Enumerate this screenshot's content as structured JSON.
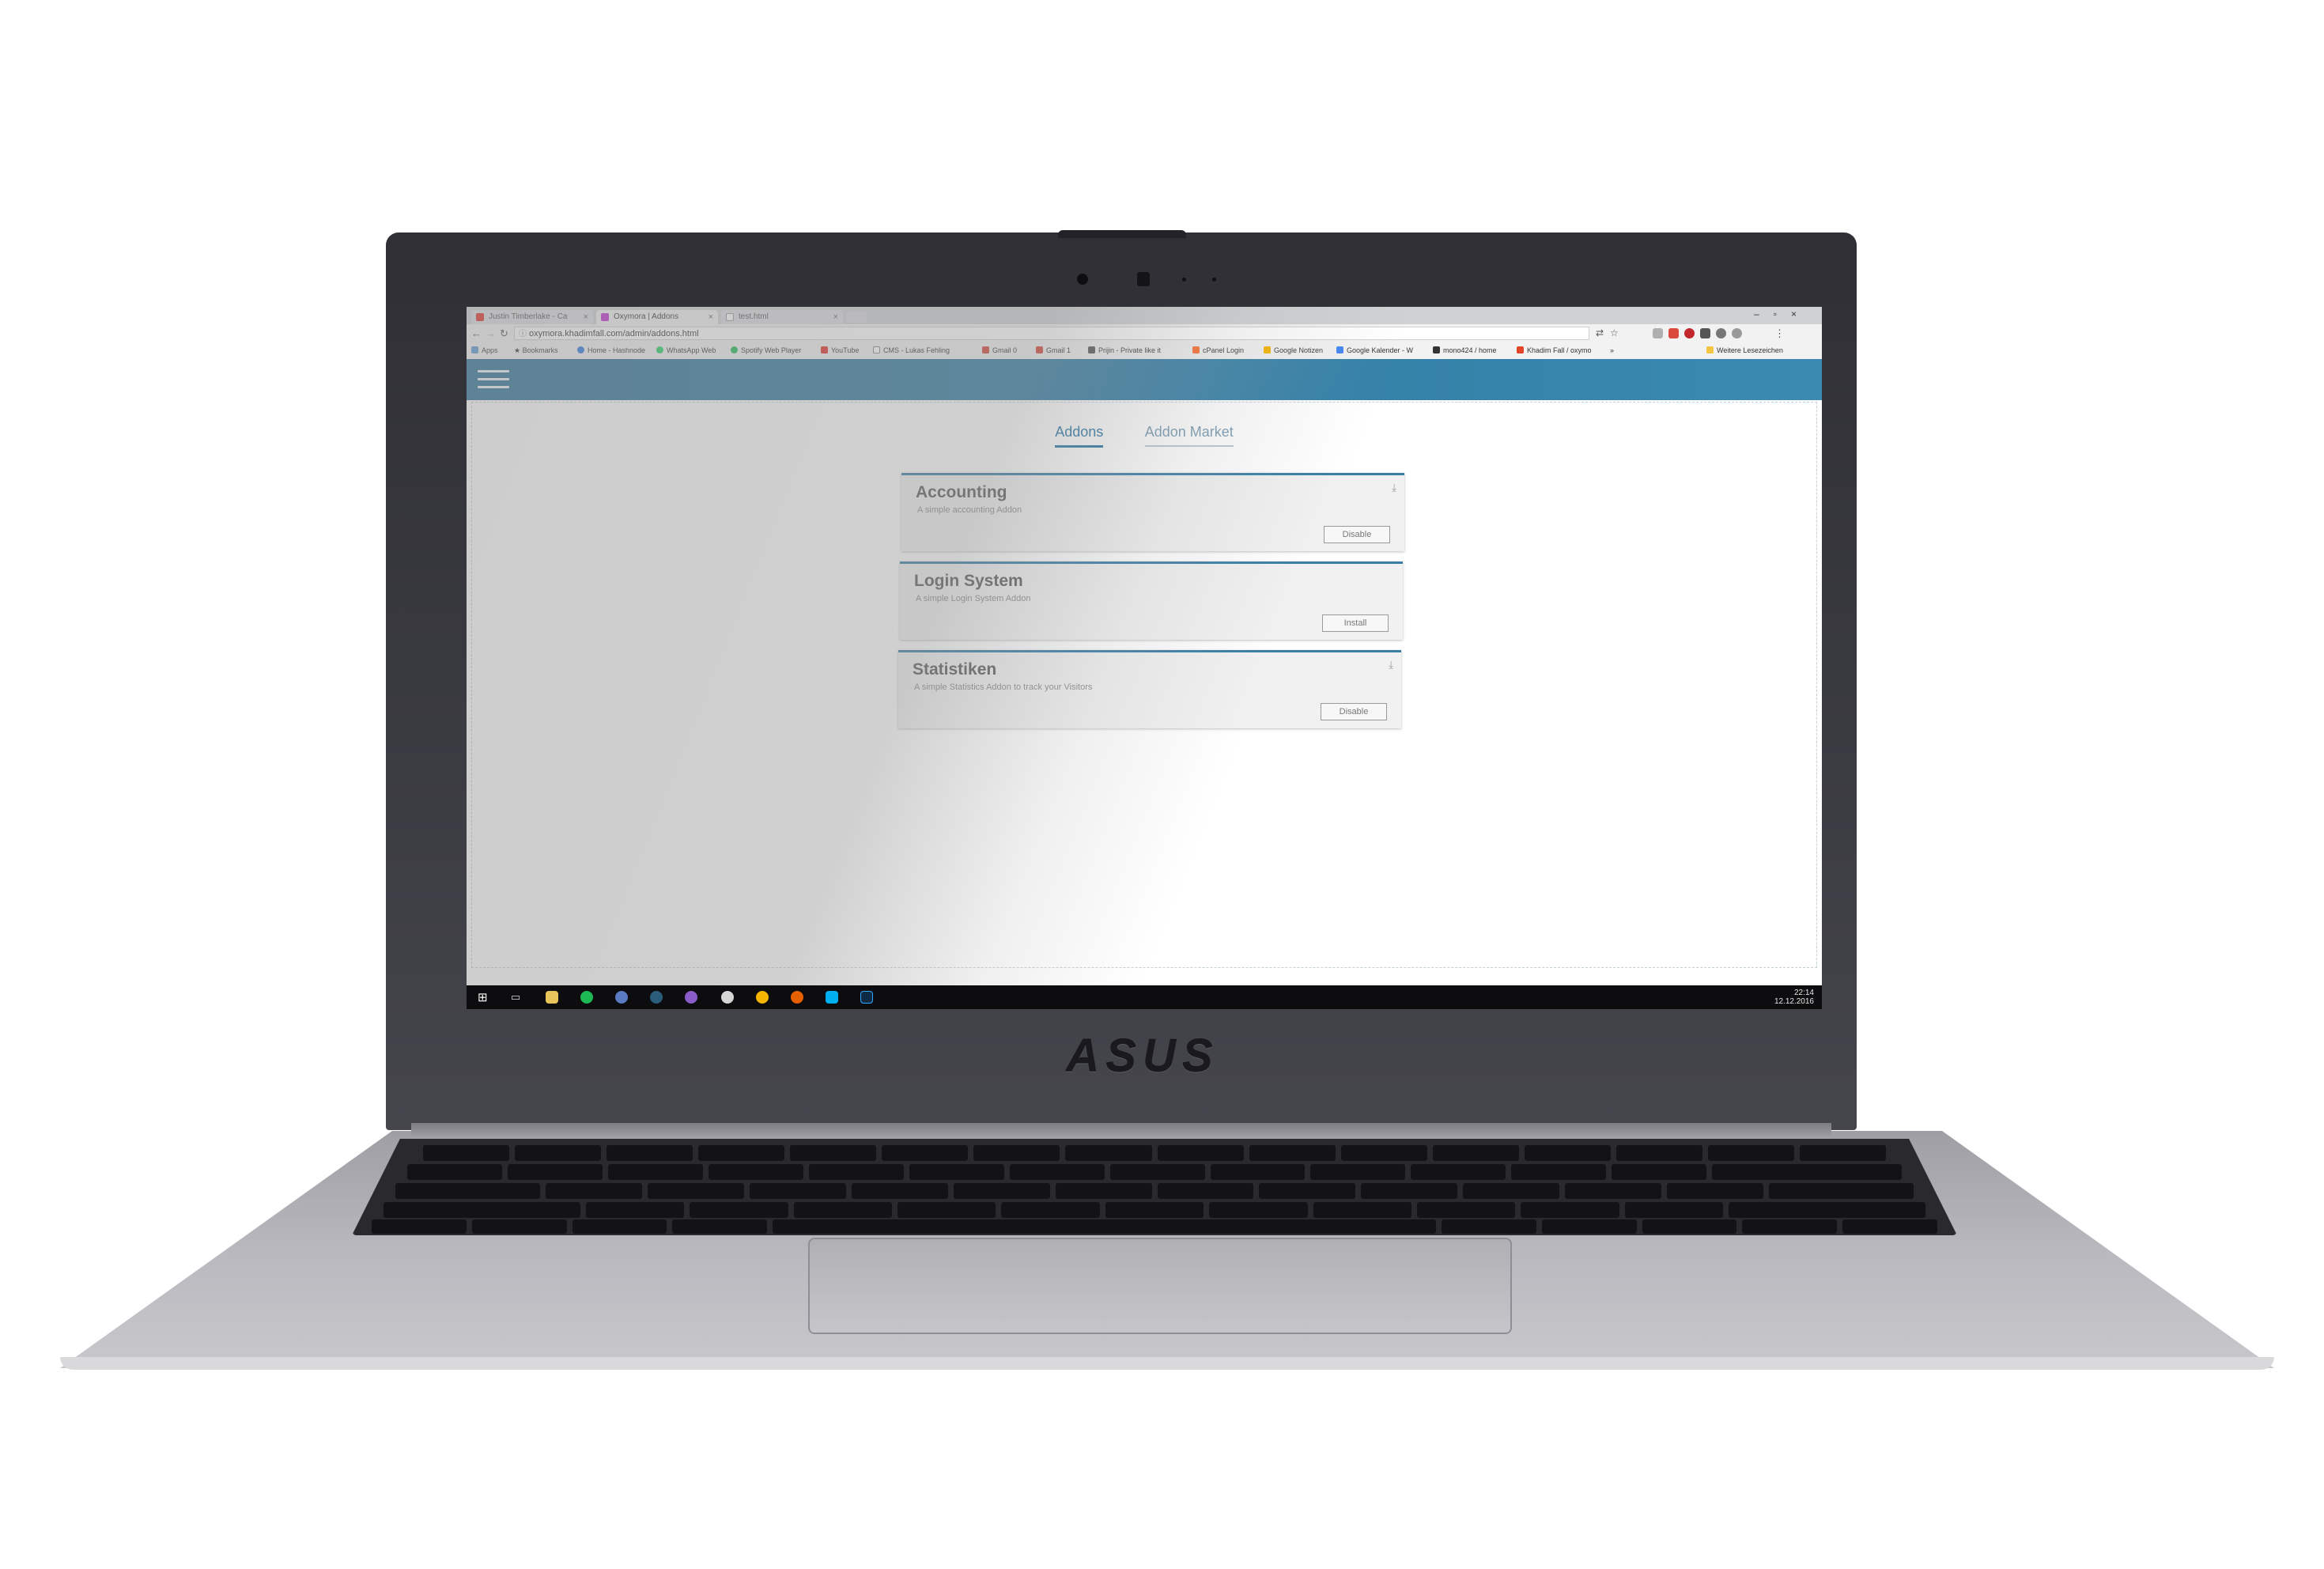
{
  "browser": {
    "tabs": [
      {
        "label": "Justin Timberlake - Ca",
        "favicon_color": "#e52d27"
      },
      {
        "label": "Oxymora | Addons",
        "favicon_color": "#c02bd0"
      },
      {
        "label": "test.html",
        "favicon_color": "#9e9e9e"
      }
    ],
    "url": "oxymora.khadimfall.com/admin/addons.html",
    "bookmarks": [
      {
        "label": "Apps",
        "color": "#5b9bd5"
      },
      {
        "label": "Bookmarks",
        "color": "#333333"
      },
      {
        "label": "Home - Hashnode",
        "color": "#2a7ae2"
      },
      {
        "label": "WhatsApp Web",
        "color": "#25d366"
      },
      {
        "label": "Spotify Web Player",
        "color": "#1db954"
      },
      {
        "label": "YouTube",
        "color": "#e52d27"
      },
      {
        "label": "CMS - Lukas Fehling",
        "color": "#888888"
      },
      {
        "label": "Gmail 0",
        "color": "#d44638"
      },
      {
        "label": "Gmail 1",
        "color": "#d44638"
      },
      {
        "label": "Prijin - Private like it",
        "color": "#555555"
      },
      {
        "label": "cPanel Login",
        "color": "#ff6c2c"
      },
      {
        "label": "Google Notizen",
        "color": "#f4b400"
      },
      {
        "label": "Google Kalender - W",
        "color": "#4285f4"
      },
      {
        "label": "mono424 / home",
        "color": "#333333"
      },
      {
        "label": "Khadim Fall / oxymo",
        "color": "#e24329"
      },
      {
        "label": "»",
        "color": ""
      },
      {
        "label": "Weitere Lesezeichen",
        "color": "#f4c542"
      }
    ]
  },
  "app": {
    "nav_tabs": [
      {
        "label": "Addons",
        "active": true
      },
      {
        "label": "Addon Market",
        "active": false
      }
    ],
    "addons": [
      {
        "title": "Accounting",
        "description": "A simple accounting Addon",
        "button": "Disable"
      },
      {
        "title": "Login System",
        "description": "A simple Login System Addon",
        "button": "Install"
      },
      {
        "title": "Statistiken",
        "description": "A simple Statistics Addon to track your Visitors",
        "button": "Disable"
      }
    ],
    "header_color": "#2f7aa3"
  },
  "taskbar": {
    "time": "22:14",
    "date": "12.12.2016"
  },
  "laptop": {
    "brand": "ASUS"
  }
}
